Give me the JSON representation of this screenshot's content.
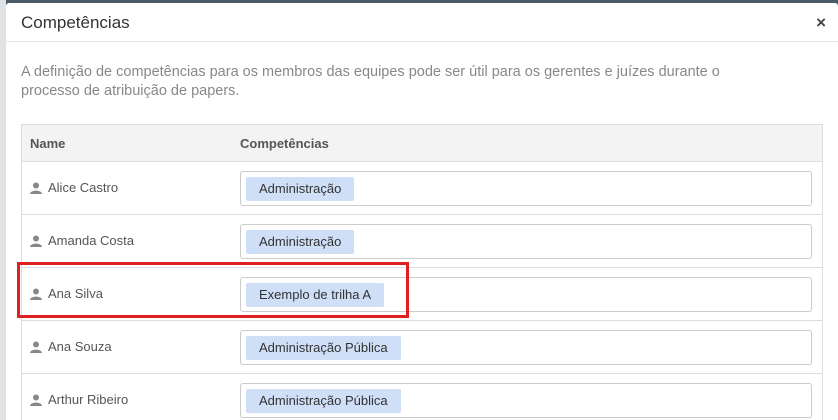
{
  "modal": {
    "title": "Competências",
    "close_label": "×",
    "description": "A definição de competências para os membros das equipes pode ser útil para os gerentes e juízes durante o processo de atribuição de papers."
  },
  "table": {
    "headers": {
      "name": "Name",
      "competencias": "Competências"
    },
    "rows": [
      {
        "name": "Alice Castro",
        "tag": "Administração"
      },
      {
        "name": "Amanda Costa",
        "tag": "Administração"
      },
      {
        "name": "Ana Silva",
        "tag": "Exemplo de trilha A"
      },
      {
        "name": "Ana Souza",
        "tag": "Administração Pública"
      },
      {
        "name": "Arthur Ribeiro",
        "tag": "Administração Pública"
      }
    ]
  },
  "colors": {
    "highlight": "#e02020",
    "tag_bg": "#cfdff7"
  },
  "icons": {
    "row_icon": "user-icon",
    "close": "close-icon"
  }
}
